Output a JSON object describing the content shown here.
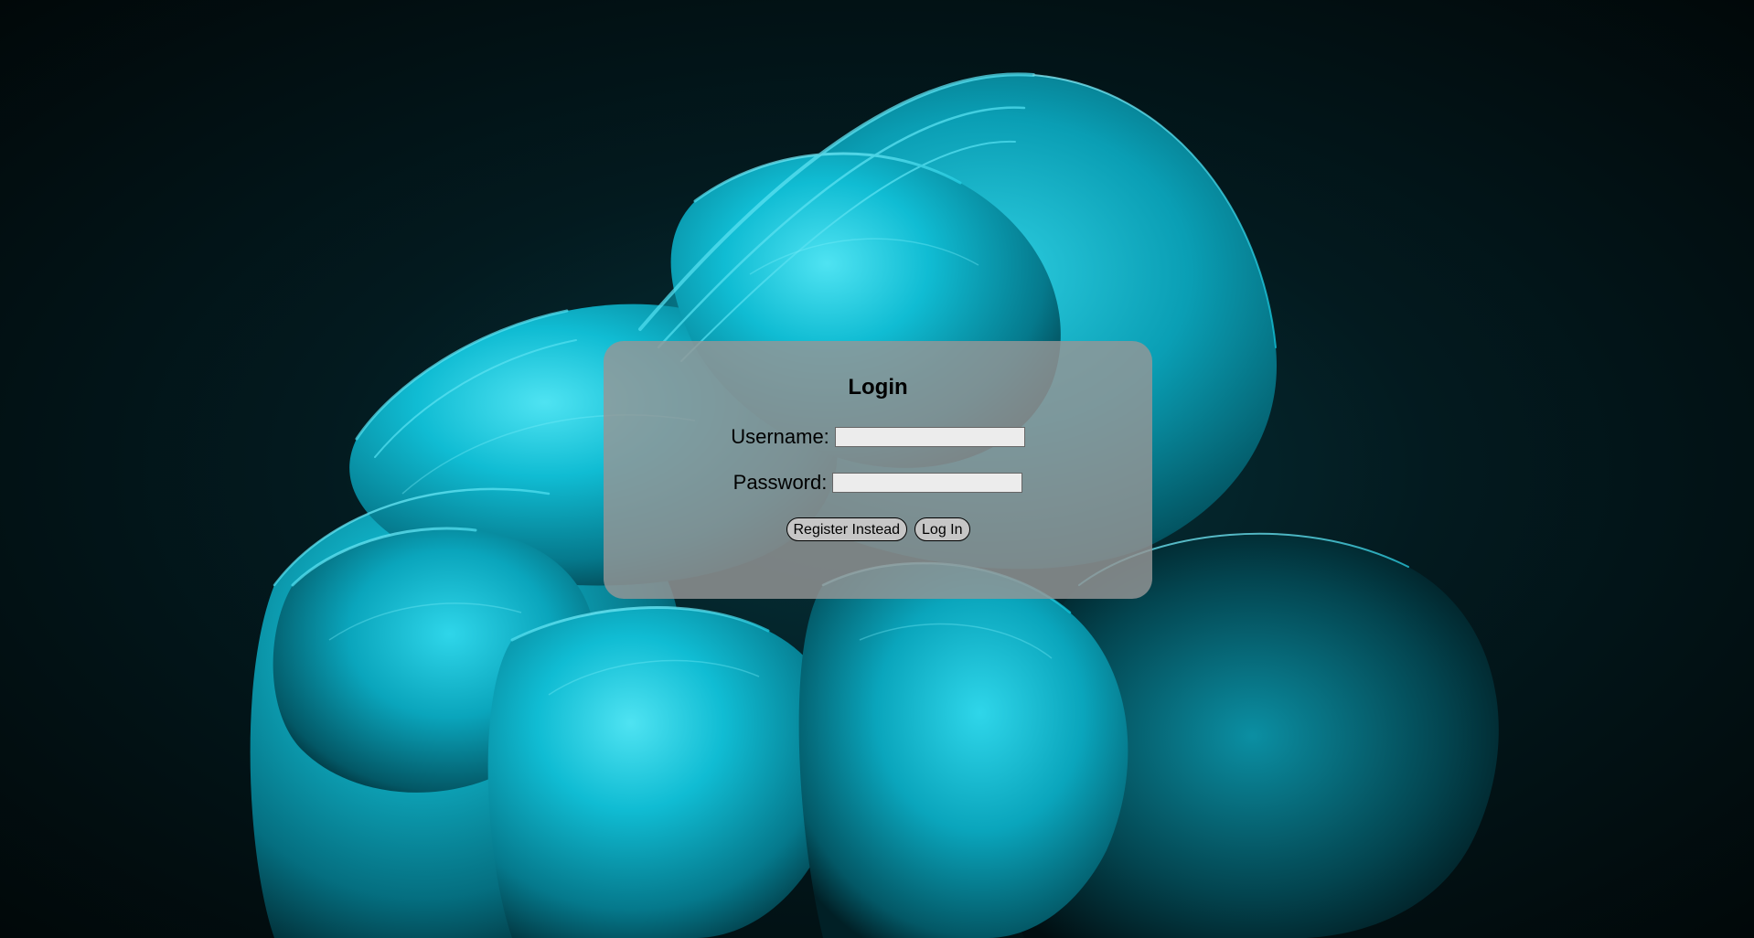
{
  "login": {
    "title": "Login",
    "username_label": "Username:",
    "username_value": "",
    "password_label": "Password:",
    "password_value": "",
    "register_button": "Register Instead",
    "login_button": "Log In"
  },
  "colors": {
    "accent": "#00b8d4",
    "card": "#969696",
    "background": "#021417"
  }
}
